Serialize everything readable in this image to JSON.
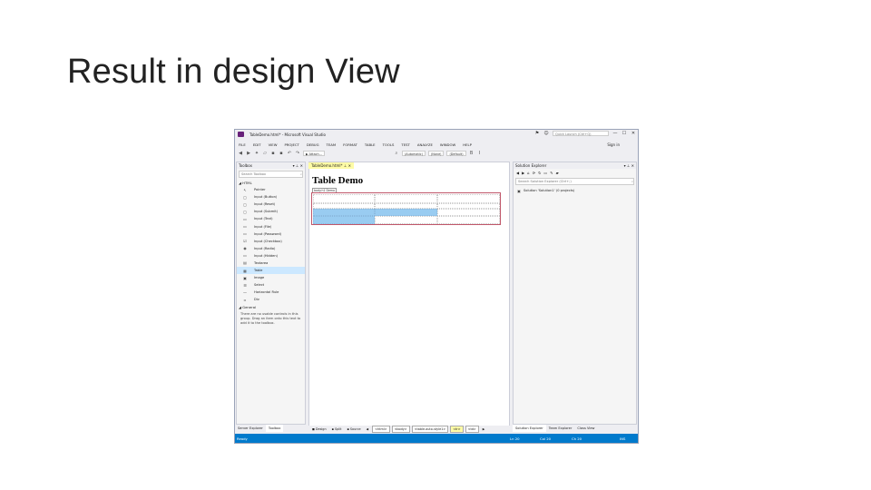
{
  "slide": {
    "title": "Result in design View"
  },
  "window": {
    "title": "TableDemo.html* - Microsoft Visual Studio",
    "quick_launch_placeholder": "Quick Launch (Ctrl+Q)",
    "minimize": "—",
    "maximize": "☐",
    "close": "✕",
    "sign_in": "Sign in"
  },
  "menu": [
    "FILE",
    "EDIT",
    "VIEW",
    "PROJECT",
    "DEBUG",
    "TEAM",
    "FORMAT",
    "TABLE",
    "TOOLS",
    "TEST",
    "ANALYZE",
    "WINDOW",
    "HELP"
  ],
  "toolbar": {
    "attach": "▶ Attach...",
    "automatic": "(Automatic)",
    "none": "(None)",
    "default": "(Default)"
  },
  "toolbox": {
    "title": "Toolbox",
    "search_placeholder": "Search Toolbox",
    "html_group": "◢ HTML",
    "items": [
      {
        "icon": "pointer-icon",
        "glyph": "↖",
        "label": "Pointer"
      },
      {
        "icon": "input-button-icon",
        "glyph": "▢",
        "label": "Input (Button)"
      },
      {
        "icon": "input-reset-icon",
        "glyph": "▢",
        "label": "Input (Reset)"
      },
      {
        "icon": "input-submit-icon",
        "glyph": "▢",
        "label": "Input (Submit)"
      },
      {
        "icon": "input-text-icon",
        "glyph": "▭",
        "label": "Input (Text)"
      },
      {
        "icon": "input-file-icon",
        "glyph": "▭",
        "label": "Input (File)"
      },
      {
        "icon": "input-password-icon",
        "glyph": "▭",
        "label": "Input (Password)"
      },
      {
        "icon": "input-checkbox-icon",
        "glyph": "☑",
        "label": "Input (Checkbox)"
      },
      {
        "icon": "input-radio-icon",
        "glyph": "◉",
        "label": "Input (Radio)"
      },
      {
        "icon": "input-hidden-icon",
        "glyph": "▭",
        "label": "Input (Hidden)"
      },
      {
        "icon": "textarea-icon",
        "glyph": "▤",
        "label": "Textarea"
      },
      {
        "icon": "table-icon",
        "glyph": "▦",
        "label": "Table"
      },
      {
        "icon": "image-icon",
        "glyph": "▣",
        "label": "Image"
      },
      {
        "icon": "select-icon",
        "glyph": "☰",
        "label": "Select"
      },
      {
        "icon": "horizontal-rule-icon",
        "glyph": "—",
        "label": "Horizontal Rule"
      },
      {
        "icon": "div-icon",
        "glyph": "▫",
        "label": "Div"
      }
    ],
    "general_group": "◢ General",
    "hint": "There are no usable controls in this group. Drag an item onto this text to add it to the toolbox."
  },
  "editor": {
    "tab_label": "TableDemo.html*",
    "heading": "Table Demo",
    "heading_tag": "body.h1 Demo",
    "bottom_tabs": [
      "◼ Design",
      "▪ Split",
      "▪ Source"
    ],
    "breadcrumbs": [
      "<html>",
      "<body>",
      "<table.auto-style1>",
      "<tr>",
      "<td>"
    ]
  },
  "solution_explorer": {
    "title": "Solution Explorer",
    "search_placeholder": "Search Solution Explorer (Ctrl+;)",
    "item": "Solution 'Solution1' (0 projects)"
  },
  "bottom_tabs_left": [
    "Server Explorer",
    "Toolbox"
  ],
  "bottom_tabs_right": [
    "Solution Explorer",
    "Team Explorer",
    "Class View"
  ],
  "status": {
    "ready": "Ready",
    "ln": "Ln 20",
    "col": "Col 20",
    "ch": "Ch 20",
    "ins": "INS"
  }
}
